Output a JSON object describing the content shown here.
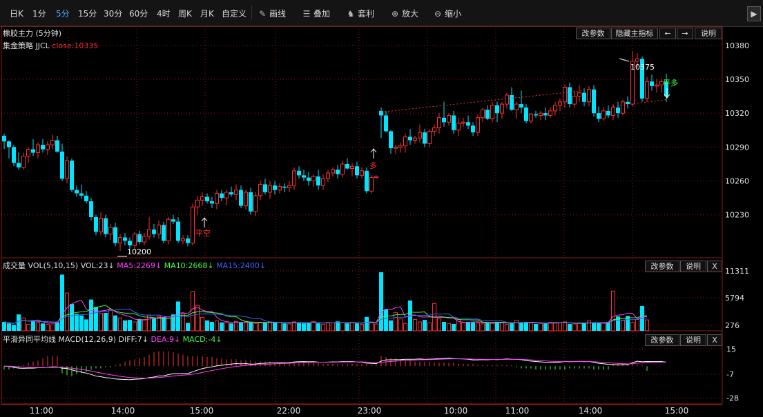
{
  "toolbar": {
    "periods": [
      "日K",
      "1分",
      "5分",
      "15分",
      "30分",
      "60分",
      "4时",
      "周K",
      "月K",
      "自定义"
    ],
    "active_period": "5分",
    "tools": [
      {
        "icon": "pencil-icon",
        "label": "画线"
      },
      {
        "icon": "stack-icon",
        "label": "叠加"
      },
      {
        "icon": "money-bag-icon",
        "label": "套利"
      },
      {
        "icon": "zoom-in-icon",
        "label": "放大"
      },
      {
        "icon": "zoom-out-icon",
        "label": "缩小"
      }
    ],
    "expand_arrow": "▶"
  },
  "main_panel": {
    "title": "橡胶主力 (5分钟)",
    "strategy": "集金策略 JJCL",
    "close_label": "close:10335",
    "buttons": [
      "改参数",
      "隐藏主指标",
      "←",
      "→",
      "说明"
    ]
  },
  "volume_panel": {
    "title": "成交量",
    "vol_label": "VOL(5,10,15)",
    "vol_value": "VOL:23↓",
    "ma5": "MA5:2269↓",
    "ma10": "MA10:2668↓",
    "ma15": "MA15:2400↓",
    "buttons": [
      "改参数",
      "说明",
      "X"
    ]
  },
  "macd_panel": {
    "title": "平滑异同平均线",
    "macd_label": "MACD(12,26,9)",
    "diff": "DIFF:7↓",
    "dea": "DEA:9↓",
    "macd": "MACD:-4↓",
    "buttons": [
      "改参数",
      "说明",
      "X"
    ]
  },
  "colors": {
    "up": "#ff3030",
    "down": "#00e5ff",
    "ma5": "#ff40ff",
    "ma10": "#40ff40",
    "ma15": "#4060ff",
    "grid": "#8b1a1a"
  },
  "chart_data": {
    "type": "candlestick",
    "price_ticks": [
      10380,
      10350,
      10320,
      10290,
      10260,
      10230
    ],
    "volume_ticks": [
      11311,
      5794,
      276
    ],
    "macd_ticks": [
      15,
      -7,
      -28
    ],
    "time_labels": [
      "11:00",
      "14:00",
      "15:00",
      "22:00",
      "23:00",
      "10:00",
      "11:00",
      "14:00",
      "15:00"
    ],
    "annotations": [
      {
        "text": "10200",
        "type": "low"
      },
      {
        "text": "10375",
        "type": "high"
      },
      {
        "text": "平空",
        "type": "signal",
        "color": "#ff3030"
      },
      {
        "text": "多",
        "type": "signal",
        "color": "#ff3030"
      },
      {
        "text": "平多",
        "type": "signal",
        "color": "#40ff40"
      }
    ],
    "ohlc": [
      [
        10300,
        10302,
        10288,
        10295
      ],
      [
        10295,
        10296,
        10280,
        10290
      ],
      [
        10290,
        10292,
        10273,
        10276
      ],
      [
        10276,
        10285,
        10270,
        10272
      ],
      [
        10272,
        10285,
        10270,
        10282
      ],
      [
        10282,
        10290,
        10276,
        10288
      ],
      [
        10288,
        10297,
        10282,
        10285
      ],
      [
        10285,
        10294,
        10280,
        10292
      ],
      [
        10292,
        10297,
        10285,
        10288
      ],
      [
        10288,
        10295,
        10283,
        10292
      ],
      [
        10292,
        10301,
        10288,
        10296
      ],
      [
        10296,
        10300,
        10285,
        10286
      ],
      [
        10286,
        10293,
        10260,
        10262
      ],
      [
        10262,
        10282,
        10258,
        10278
      ],
      [
        10278,
        10280,
        10250,
        10252
      ],
      [
        10252,
        10256,
        10246,
        10249
      ],
      [
        10249,
        10257,
        10244,
        10247
      ],
      [
        10247,
        10251,
        10240,
        10242
      ],
      [
        10242,
        10245,
        10225,
        10228
      ],
      [
        10228,
        10230,
        10212,
        10215
      ],
      [
        10215,
        10232,
        10212,
        10227
      ],
      [
        10227,
        10230,
        10210,
        10213
      ],
      [
        10213,
        10222,
        10208,
        10219
      ],
      [
        10219,
        10223,
        10202,
        10205
      ],
      [
        10205,
        10213,
        10198,
        10210
      ],
      [
        10210,
        10214,
        10203,
        10207
      ],
      [
        10207,
        10210,
        10200,
        10203
      ],
      [
        10203,
        10215,
        10200,
        10213
      ],
      [
        10213,
        10216,
        10204,
        10206
      ],
      [
        10206,
        10214,
        10203,
        10211
      ],
      [
        10211,
        10228,
        10208,
        10217
      ],
      [
        10217,
        10222,
        10210,
        10213
      ],
      [
        10213,
        10225,
        10209,
        10221
      ],
      [
        10221,
        10224,
        10205,
        10207
      ],
      [
        10207,
        10228,
        10204,
        10226
      ],
      [
        10226,
        10230,
        10222,
        10224
      ],
      [
        10224,
        10228,
        10205,
        10207
      ],
      [
        10207,
        10212,
        10204,
        10209
      ],
      [
        10209,
        10212,
        10202,
        10205
      ],
      [
        10205,
        10240,
        10203,
        10237
      ],
      [
        10237,
        10247,
        10230,
        10243
      ],
      [
        10243,
        10250,
        10238,
        10246
      ],
      [
        10246,
        10249,
        10240,
        10242
      ],
      [
        10242,
        10246,
        10236,
        10240
      ],
      [
        10240,
        10252,
        10235,
        10249
      ],
      [
        10249,
        10252,
        10242,
        10245
      ],
      [
        10245,
        10252,
        10238,
        10250
      ],
      [
        10250,
        10255,
        10246,
        10248
      ],
      [
        10248,
        10257,
        10243,
        10252
      ],
      [
        10252,
        10256,
        10236,
        10238
      ],
      [
        10238,
        10252,
        10235,
        10250
      ],
      [
        10250,
        10254,
        10230,
        10233
      ],
      [
        10233,
        10250,
        10229,
        10247
      ],
      [
        10247,
        10260,
        10243,
        10257
      ],
      [
        10257,
        10262,
        10248,
        10250
      ],
      [
        10250,
        10260,
        10244,
        10256
      ],
      [
        10256,
        10260,
        10248,
        10252
      ],
      [
        10252,
        10258,
        10249,
        10255
      ],
      [
        10255,
        10258,
        10250,
        10254
      ],
      [
        10254,
        10260,
        10250,
        10256
      ],
      [
        10256,
        10272,
        10252,
        10269
      ],
      [
        10269,
        10273,
        10262,
        10265
      ],
      [
        10265,
        10270,
        10260,
        10263
      ],
      [
        10263,
        10268,
        10256,
        10260
      ],
      [
        10260,
        10266,
        10255,
        10264
      ],
      [
        10264,
        10270,
        10252,
        10256
      ],
      [
        10256,
        10266,
        10252,
        10262
      ],
      [
        10262,
        10270,
        10259,
        10267
      ],
      [
        10267,
        10272,
        10264,
        10270
      ],
      [
        10270,
        10274,
        10262,
        10266
      ],
      [
        10266,
        10278,
        10263,
        10275
      ],
      [
        10275,
        10280,
        10270,
        10271
      ],
      [
        10271,
        10276,
        10264,
        10273
      ],
      [
        10273,
        10277,
        10262,
        10265
      ],
      [
        10265,
        10272,
        10262,
        10269
      ],
      [
        10269,
        10272,
        10249,
        10251
      ],
      [
        10251,
        10265,
        10249,
        10263
      ],
      [
        10263,
        10265,
        10262,
        10264
      ],
      [
        10322,
        10325,
        10298,
        10318
      ],
      [
        10318,
        10322,
        10303,
        10304
      ],
      [
        10304,
        10305,
        10284,
        10289
      ],
      [
        10289,
        10292,
        10284,
        10290
      ],
      [
        10290,
        10294,
        10285,
        10291
      ],
      [
        10291,
        10302,
        10285,
        10299
      ],
      [
        10299,
        10306,
        10292,
        10296
      ],
      [
        10296,
        10300,
        10293,
        10298
      ],
      [
        10298,
        10310,
        10294,
        10303
      ],
      [
        10303,
        10306,
        10290,
        10293
      ],
      [
        10293,
        10306,
        10290,
        10304
      ],
      [
        10304,
        10310,
        10300,
        10307
      ],
      [
        10307,
        10320,
        10302,
        10316
      ],
      [
        10316,
        10330,
        10308,
        10312
      ],
      [
        10312,
        10320,
        10309,
        10318
      ],
      [
        10318,
        10322,
        10302,
        10305
      ],
      [
        10305,
        10316,
        10300,
        10311
      ],
      [
        10311,
        10316,
        10308,
        10312
      ],
      [
        10312,
        10318,
        10306,
        10309
      ],
      [
        10309,
        10312,
        10300,
        10303
      ],
      [
        10303,
        10319,
        10300,
        10316
      ],
      [
        10316,
        10325,
        10312,
        10323
      ],
      [
        10323,
        10327,
        10314,
        10315
      ],
      [
        10315,
        10330,
        10312,
        10327
      ],
      [
        10327,
        10330,
        10312,
        10320
      ],
      [
        10320,
        10330,
        10315,
        10328
      ],
      [
        10328,
        10338,
        10324,
        10336
      ],
      [
        10336,
        10343,
        10322,
        10323
      ],
      [
        10323,
        10330,
        10315,
        10328
      ],
      [
        10328,
        10340,
        10320,
        10325
      ],
      [
        10325,
        10328,
        10311,
        10313
      ],
      [
        10313,
        10320,
        10311,
        10319
      ],
      [
        10319,
        10322,
        10316,
        10318
      ],
      [
        10318,
        10322,
        10314,
        10320
      ],
      [
        10320,
        10325,
        10314,
        10318
      ],
      [
        10318,
        10325,
        10316,
        10322
      ],
      [
        10322,
        10330,
        10318,
        10327
      ],
      [
        10327,
        10333,
        10322,
        10330
      ],
      [
        10330,
        10345,
        10325,
        10343
      ],
      [
        10343,
        10347,
        10325,
        10328
      ],
      [
        10328,
        10340,
        10325,
        10335
      ],
      [
        10335,
        10345,
        10330,
        10338
      ],
      [
        10338,
        10342,
        10326,
        10330
      ],
      [
        10330,
        10344,
        10326,
        10341
      ],
      [
        10341,
        10345,
        10317,
        10320
      ],
      [
        10320,
        10326,
        10312,
        10315
      ],
      [
        10315,
        10325,
        10313,
        10322
      ],
      [
        10322,
        10327,
        10316,
        10318
      ],
      [
        10318,
        10328,
        10314,
        10325
      ],
      [
        10325,
        10330,
        10316,
        10320
      ],
      [
        10320,
        10332,
        10318,
        10330
      ],
      [
        10330,
        10335,
        10324,
        10328
      ],
      [
        10328,
        10375,
        10326,
        10366
      ],
      [
        10366,
        10373,
        10360,
        10368
      ],
      [
        10368,
        10370,
        10330,
        10333
      ],
      [
        10333,
        10352,
        10330,
        10348
      ],
      [
        10348,
        10354,
        10340,
        10344
      ],
      [
        10344,
        10350,
        10338,
        10345
      ],
      [
        10345,
        10350,
        10338,
        10348
      ],
      [
        10348,
        10355,
        10330,
        10335
      ]
    ],
    "volume": [
      1800,
      1500,
      1200,
      3300,
      2600,
      1300,
      2000,
      1700,
      1500,
      1300,
      1200,
      1700,
      11311,
      7600,
      5400,
      3400,
      3100,
      2300,
      6300,
      4800,
      3500,
      3600,
      4300,
      3100,
      2600,
      2100,
      2200,
      1800,
      2400,
      2300,
      3200,
      2600,
      2900,
      2700,
      2800,
      3300,
      5900,
      3500,
      1600,
      7900,
      5100,
      2700,
      2100,
      1800,
      2000,
      1700,
      1700,
      1500,
      1900,
      1700,
      1800,
      1700,
      1500,
      1600,
      1700,
      1800,
      1600,
      1700,
      1500,
      1400,
      1800,
      1700,
      1500,
      1600,
      1900,
      1500,
      1300,
      1700,
      1600,
      1900,
      1600,
      1500,
      1700,
      1500,
      1300,
      2800,
      1600,
      1400,
      11800,
      4300,
      2100,
      3700,
      2400,
      1500,
      6100,
      2300,
      1800,
      2200,
      1600,
      5500,
      2500,
      1800,
      1500,
      1400,
      2300,
      1700,
      1800,
      1700,
      1600,
      1400,
      1700,
      1500,
      1800,
      1600,
      1300,
      1500,
      2100,
      1700,
      1800,
      1600,
      1400,
      1500,
      1500,
      1700,
      1700,
      1600,
      1800,
      1400,
      1400,
      1500,
      1500,
      2000,
      1700,
      1600,
      1500,
      1800,
      8000,
      2900,
      2100,
      3000,
      1700,
      2300,
      5000,
      2200
    ],
    "macd_hist": [
      -3,
      -3,
      -2,
      -2,
      1,
      3,
      4,
      5,
      7,
      9,
      9,
      9,
      -6,
      -8,
      -9,
      -7,
      -6,
      -5,
      -3,
      -2,
      -2,
      -1,
      -1,
      1,
      2,
      4,
      5,
      6,
      7,
      8,
      10,
      12,
      13,
      13,
      13,
      12,
      11,
      10,
      9,
      9,
      9,
      9,
      8,
      8,
      7,
      7,
      6,
      6,
      6,
      5,
      5,
      5,
      4,
      4,
      4,
      4,
      3,
      3,
      3,
      3,
      3,
      3,
      3,
      3,
      3,
      3,
      2,
      2,
      2,
      2,
      2,
      2,
      2,
      2,
      2,
      2,
      1,
      1,
      9,
      8,
      7,
      7,
      6,
      5,
      5,
      4,
      4,
      4,
      4,
      3,
      3,
      3,
      3,
      3,
      2,
      2,
      2,
      2,
      1,
      1,
      1,
      1,
      1,
      1,
      1,
      1,
      -1,
      -2,
      -2,
      -2,
      -3,
      -3,
      -3,
      -3,
      -3,
      -3,
      -3,
      -2,
      -2,
      -2,
      -2,
      -2,
      -3,
      -3,
      -3,
      -3,
      2,
      3,
      2,
      2,
      2,
      1,
      1,
      -4
    ]
  }
}
